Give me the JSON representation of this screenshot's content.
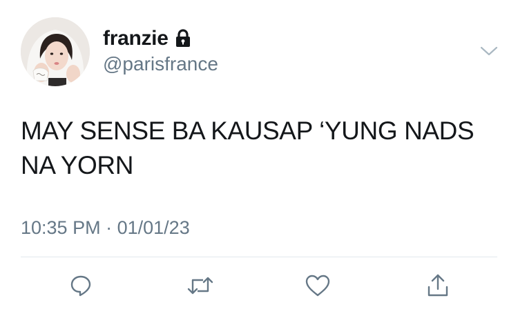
{
  "user": {
    "display_name": "franzie",
    "handle": "@parisfrance",
    "protected": true
  },
  "tweet": {
    "text": "MAY SENSE BA KAUSAP ‘YUNG NADS NA YORN",
    "time": "10:35 PM",
    "separator": "·",
    "date": "01/01/23"
  },
  "icons": {
    "lock": "lock-icon",
    "more": "chevron-down-icon",
    "reply": "reply-icon",
    "retweet": "retweet-icon",
    "like": "heart-icon",
    "share": "share-icon"
  },
  "colors": {
    "text": "#14171a",
    "secondary": "#657786",
    "icon": "#657786",
    "divider": "#e1e8ed"
  }
}
